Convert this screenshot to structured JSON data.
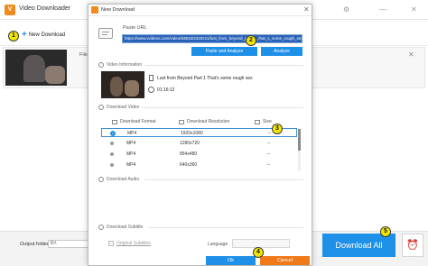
{
  "main_window": {
    "title": "Video Downloader",
    "controls": [
      "⚙",
      "—",
      "✕"
    ],
    "new_download_label": "New Download",
    "file_label": "File",
    "output_label": "Output folder:",
    "output_value": "D:\\",
    "download_all_label": "Download All"
  },
  "dialog": {
    "title": "New Download",
    "paste_url_label": "Paste URL",
    "url_value": "https://www.xvideos.com/video/63815/2320211/lust_from_beyond_part_1_that_s_some_rough_sex",
    "paste_analyze_label": "Paste and Analyze",
    "analyze_label": "Analyze",
    "video_info_label": "Video Information",
    "video_title": "Lust from Beyond Part 1 That's some rough sex",
    "duration": "01:16:12",
    "download_video_label": "Download Video",
    "table_headers": {
      "format": "Download Format",
      "resolution": "Download Resolution",
      "size": "Size"
    },
    "formats": [
      {
        "format": "MP4",
        "resolution": "1920x1080",
        "size": "--",
        "selected": true
      },
      {
        "format": "MP4",
        "resolution": "1280x720",
        "size": "--",
        "selected": false
      },
      {
        "format": "MP4",
        "resolution": "854x480",
        "size": "--",
        "selected": false
      },
      {
        "format": "MP4",
        "resolution": "640x360",
        "size": "--",
        "selected": false
      }
    ],
    "download_audio_label": "Download Audio",
    "download_subtitle_label": "Download Subtitle",
    "original_subtitles_label": "Original Subtitles",
    "language_label": "Language",
    "ok_label": "Ok",
    "cancel_label": "Cancel"
  },
  "callouts": [
    "1",
    "2",
    "3",
    "4",
    "5"
  ],
  "colors": {
    "accent_blue": "#1e90e8",
    "cancel_orange": "#f07a1a",
    "callout_yellow": "#f5e800",
    "url_highlight": "#2a62b8"
  }
}
